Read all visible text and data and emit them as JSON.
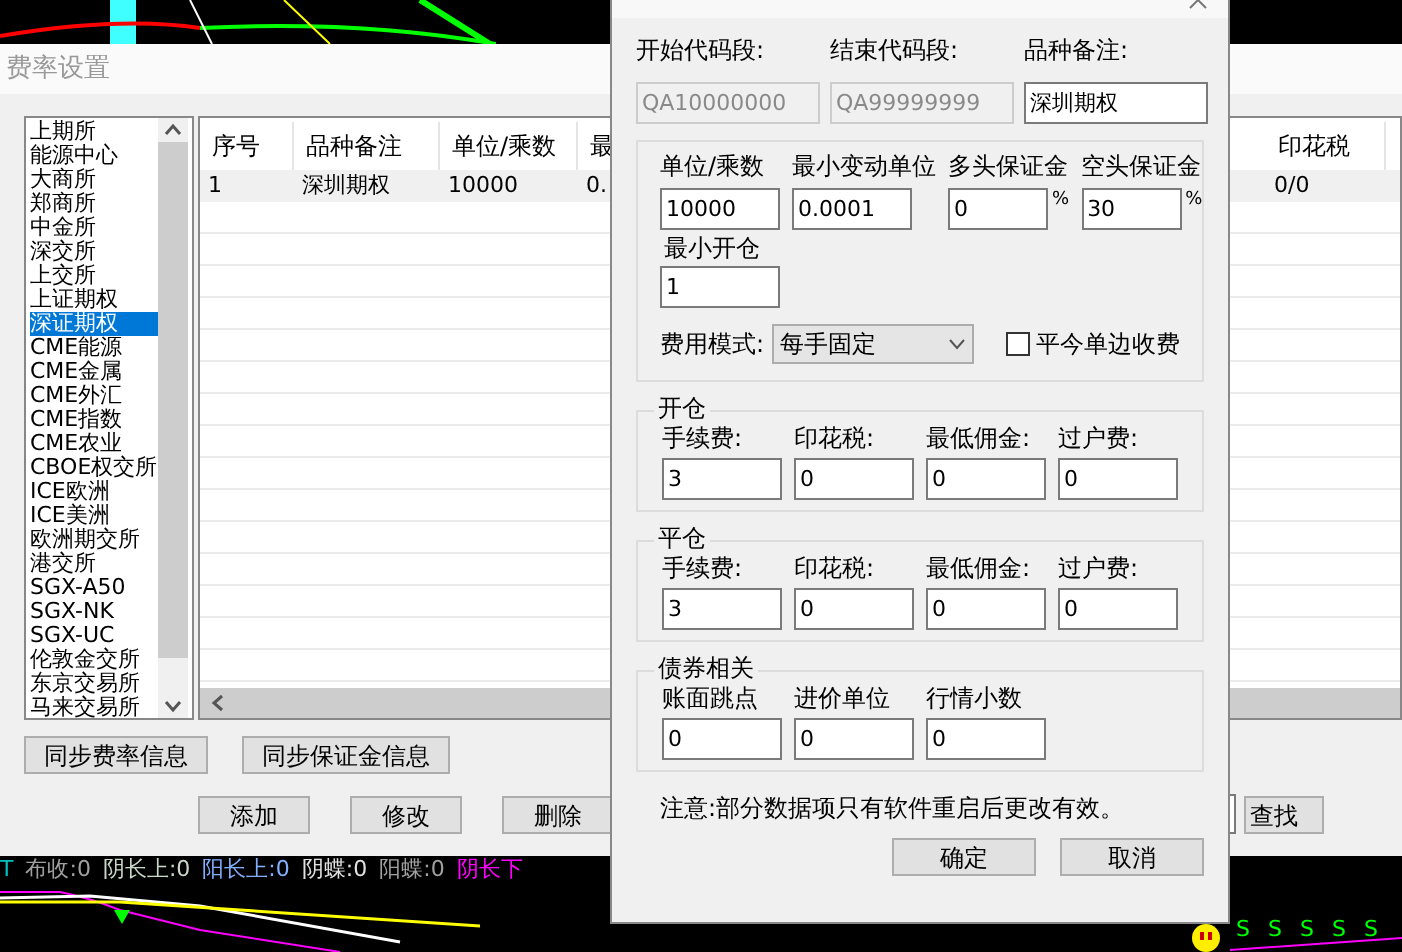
{
  "window": {
    "title": "费率设置"
  },
  "exchanges": [
    {
      "label": "上期所",
      "selected": false
    },
    {
      "label": "能源中心",
      "selected": false
    },
    {
      "label": "大商所",
      "selected": false
    },
    {
      "label": "郑商所",
      "selected": false
    },
    {
      "label": "中金所",
      "selected": false
    },
    {
      "label": "深交所",
      "selected": false
    },
    {
      "label": "上交所",
      "selected": false
    },
    {
      "label": "上证期权",
      "selected": false
    },
    {
      "label": "深证期权",
      "selected": true
    },
    {
      "label": "CME能源",
      "selected": false
    },
    {
      "label": "CME金属",
      "selected": false
    },
    {
      "label": "CME外汇",
      "selected": false
    },
    {
      "label": "CME指数",
      "selected": false
    },
    {
      "label": "CME农业",
      "selected": false
    },
    {
      "label": "CBOE权交所",
      "selected": false
    },
    {
      "label": "ICE欧洲",
      "selected": false
    },
    {
      "label": "ICE美洲",
      "selected": false
    },
    {
      "label": "欧洲期交所",
      "selected": false
    },
    {
      "label": "港交所",
      "selected": false
    },
    {
      "label": "SGX-A50",
      "selected": false
    },
    {
      "label": "SGX-NK",
      "selected": false
    },
    {
      "label": "SGX-UC",
      "selected": false
    },
    {
      "label": "伦敦金交所",
      "selected": false
    },
    {
      "label": "东京交易所",
      "selected": false
    },
    {
      "label": "马来交易所",
      "selected": false
    }
  ],
  "table": {
    "columns": [
      "序号",
      "品种备注",
      "单位/乘数",
      "最",
      "印花税"
    ],
    "rows": [
      [
        "1",
        "深圳期权",
        "10000",
        "0.",
        "0/0"
      ]
    ]
  },
  "sync_buttons": [
    "同步费率信息",
    "同步保证金信息"
  ],
  "action_buttons": [
    "添加",
    "修改",
    "删除"
  ],
  "find_button": "查找",
  "indicators": [
    {
      "text": "T",
      "color": "#00c0c0"
    },
    {
      "text": "布收:0",
      "color": "#a0a0a0"
    },
    {
      "text": "阴长上:0",
      "color": "#c8d8c8"
    },
    {
      "text": "阳长上:0",
      "color": "#80b0ff"
    },
    {
      "text": "阴蝶:0",
      "color": "#e0e0e0"
    },
    {
      "text": "阳蝶:0",
      "color": "#a0a0a0"
    },
    {
      "text": "阴长下",
      "color": "#ff00ff"
    }
  ],
  "signals": [
    "S",
    "S",
    "S",
    "S",
    "S"
  ],
  "dialog": {
    "header_fields": [
      {
        "label": "开始代码段:",
        "value": "QA10000000",
        "disabled": true
      },
      {
        "label": "结束代码段:",
        "value": "QA99999999",
        "disabled": true
      },
      {
        "label": "品种备注:",
        "value": "深圳期权",
        "disabled": false
      }
    ],
    "params": [
      {
        "label": "单位/乘数",
        "value": "10000"
      },
      {
        "label": "最小变动单位",
        "value": "0.0001"
      },
      {
        "label": "多头保证金",
        "value": "0",
        "unit": "%"
      },
      {
        "label": "空头保证金",
        "value": "30",
        "unit": "%"
      }
    ],
    "min_open": {
      "label": "最小开仓",
      "value": "1"
    },
    "fee_mode": {
      "label": "费用模式:",
      "value": "每手固定"
    },
    "one_side": {
      "label": "平今单边收费",
      "checked": false
    },
    "groups": [
      {
        "title": "开仓",
        "fields": [
          {
            "label": "手续费:",
            "value": "3"
          },
          {
            "label": "印花税:",
            "value": "0"
          },
          {
            "label": "最低佣金:",
            "value": "0"
          },
          {
            "label": "过户费:",
            "value": "0"
          }
        ]
      },
      {
        "title": "平仓",
        "fields": [
          {
            "label": "手续费:",
            "value": "3"
          },
          {
            "label": "印花税:",
            "value": "0"
          },
          {
            "label": "最低佣金:",
            "value": "0"
          },
          {
            "label": "过户费:",
            "value": "0"
          }
        ]
      },
      {
        "title": "债券相关",
        "fields": [
          {
            "label": "账面跳点",
            "value": "0"
          },
          {
            "label": "进价单位",
            "value": "0"
          },
          {
            "label": "行情小数",
            "value": "0"
          }
        ]
      }
    ],
    "note": "注意:部分数据项只有软件重启后更改有效。",
    "buttons": [
      "确定",
      "取消"
    ]
  }
}
